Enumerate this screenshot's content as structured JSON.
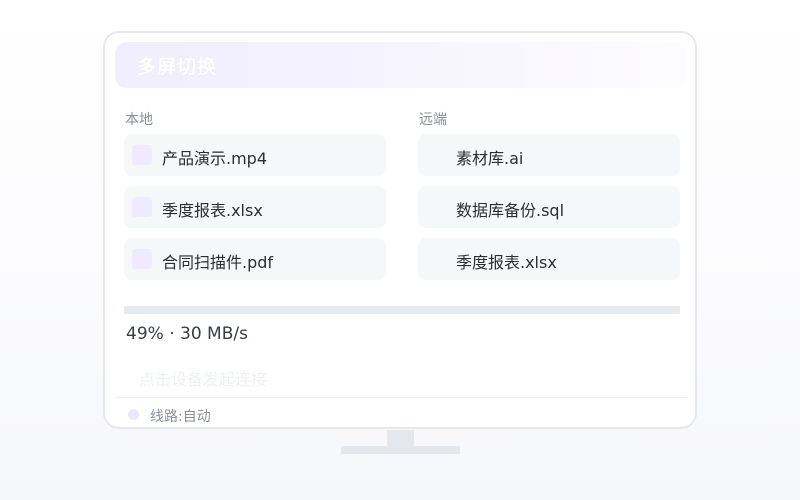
{
  "header": {
    "title": "多屏切换"
  },
  "columns": {
    "local_label": "本地",
    "remote_label": "远端"
  },
  "local_files": [
    {
      "name": "产品演示.mp4"
    },
    {
      "name": "季度报表.xlsx"
    },
    {
      "name": "合同扫描件.pdf"
    }
  ],
  "remote_files": [
    {
      "name": "素材库.ai"
    },
    {
      "name": "数据库备份.sql"
    },
    {
      "name": "季度报表.xlsx"
    }
  ],
  "transfer": {
    "progress_percent": 49,
    "status_text": "49% · 30 MB/s"
  },
  "hint": {
    "text": "点击设备发起连接"
  },
  "footer": {
    "route_text": "线路:自动"
  },
  "colors": {
    "accent_soft": "#efeafd",
    "item_bg": "#f6f7f9",
    "track": "#e7eaef"
  }
}
